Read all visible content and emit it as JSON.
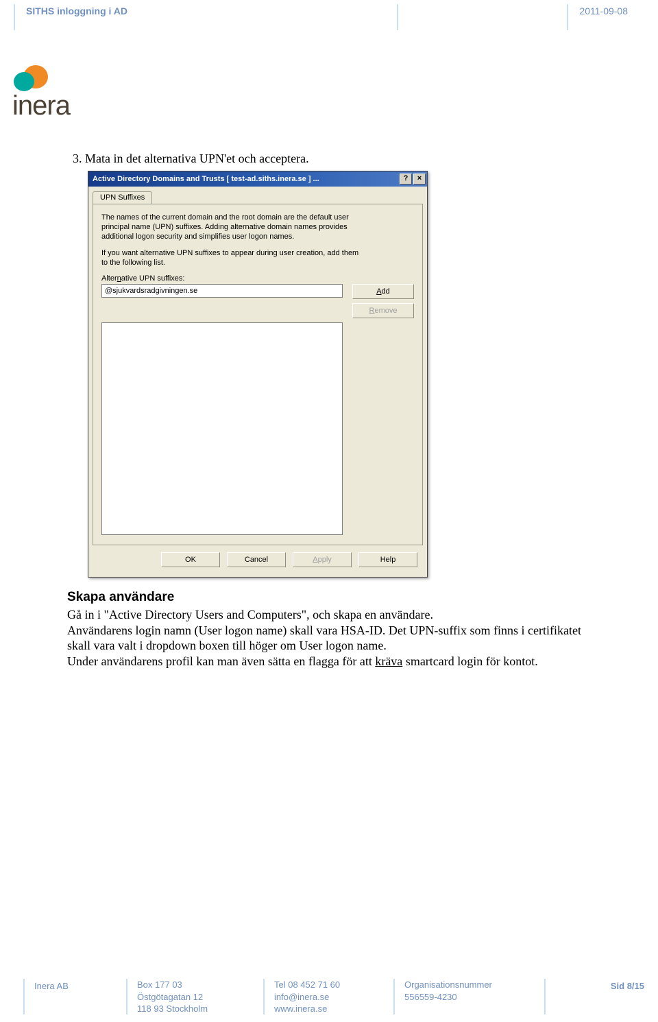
{
  "header": {
    "title": "SITHS inloggning i AD",
    "date": "2011-09-08"
  },
  "logo": {
    "text": "inera"
  },
  "body": {
    "step3": "3.  Mata in det alternativa UPN'et och acceptera.",
    "h2": "Skapa användare",
    "p1": "Gå in i \"Active Directory Users and Computers\", och skapa en användare.",
    "p2": "Användarens login namn (User logon name) skall vara HSA-ID. Det UPN-suffix som finns i certifikatet skall vara valt i dropdown boxen till höger om User logon name.",
    "p3_pre": "Under användarens profil kan man även sätta en flagga för att ",
    "p3_u": "kräva",
    "p3_post": " smartcard login för kontot."
  },
  "dialog": {
    "title": "Active Directory Domains and Trusts [ test-ad.siths.inera.se ] ...",
    "tab": "UPN Suffixes",
    "desc1": "The names of the current domain and the root domain are the default user principal name (UPN) suffixes. Adding alternative domain names provides additional logon security and simplifies user logon names.",
    "desc2": "If you want alternative UPN suffixes to appear during user creation, add them to the following list.",
    "label": "Alternative UPN suffixes:",
    "input_value": "@sjukvardsradgivningen.se",
    "btn_add": "Add",
    "btn_remove": "Remove",
    "btn_ok": "OK",
    "btn_cancel": "Cancel",
    "btn_apply": "Apply",
    "btn_help": "Help"
  },
  "footer": {
    "company": "Inera AB",
    "box": "Box 177 03",
    "street": "Östgötagatan 12",
    "city": "118 93 Stockholm",
    "tel": "Tel 08 452 71 60",
    "email": "info@inera.se",
    "web": "www.inera.se",
    "org_label": "Organisationsnummer",
    "org_num": "556559-4230",
    "page": "Sid 8/15"
  }
}
